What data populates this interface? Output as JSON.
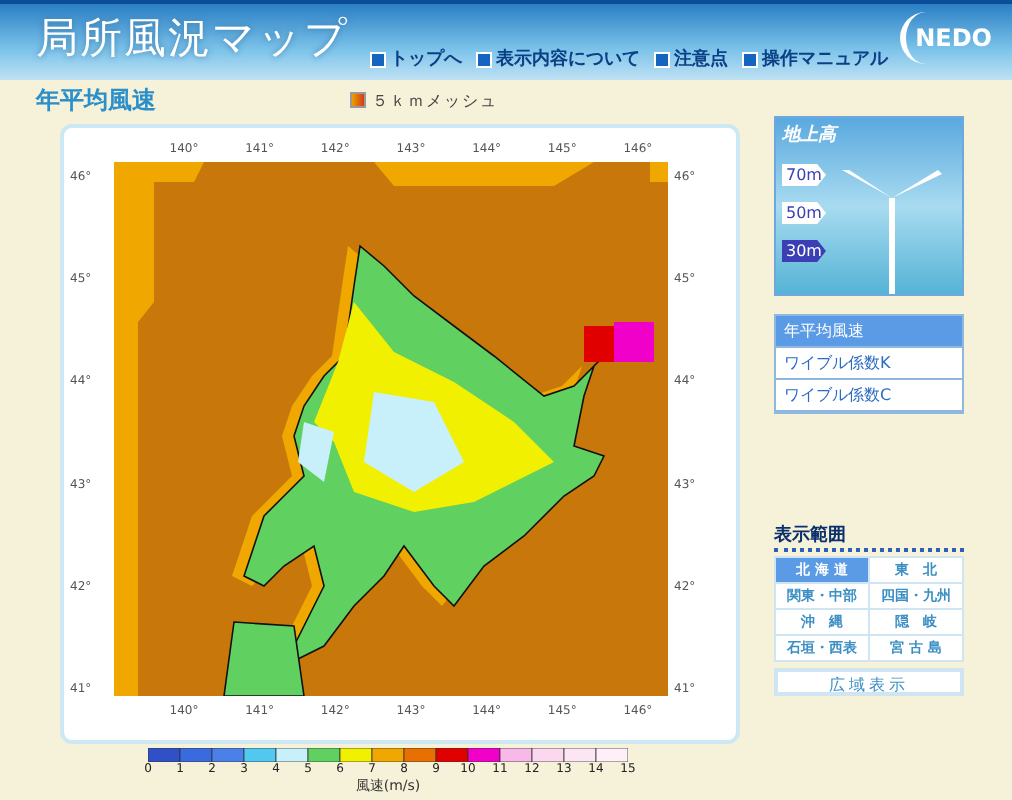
{
  "header": {
    "title": "局所風況マップ",
    "logo": "NEDO",
    "nav": [
      "トップへ",
      "表示内容について",
      "注意点",
      "操作マニュアル"
    ]
  },
  "page_title": "年平均風速",
  "mesh_label": "５ｋｍメッシュ",
  "map": {
    "lon_labels_top": [
      "140°",
      "141°",
      "142°",
      "143°",
      "144°",
      "145°",
      "146°"
    ],
    "lat_labels_left": [
      "46°",
      "45°",
      "44°",
      "43°",
      "42°",
      "41°"
    ],
    "lat_labels_right": [
      "46°",
      "45°",
      "44°",
      "43°",
      "42°",
      "41°"
    ],
    "lon_labels_bottom": [
      "140°",
      "141°",
      "142°",
      "143°",
      "144°",
      "145°",
      "146°"
    ],
    "legend_ticks": [
      "0",
      "1",
      "2",
      "3",
      "4",
      "5",
      "6",
      "7",
      "8",
      "9",
      "10",
      "11",
      "12",
      "13",
      "14",
      "15"
    ],
    "legend_title": "風速(m/s)"
  },
  "height_panel": {
    "title": "地上高",
    "options": [
      {
        "label": "70m",
        "selected": false
      },
      {
        "label": "50m",
        "selected": false
      },
      {
        "label": "30m",
        "selected": true
      }
    ]
  },
  "layer_menu": [
    {
      "label": "年平均風速",
      "selected": true
    },
    {
      "label": "ワイブル係数K",
      "selected": false
    },
    {
      "label": "ワイブル係数C",
      "selected": false
    }
  ],
  "region": {
    "title": "表示範囲",
    "items": [
      {
        "label": "北 海 道",
        "selected": true
      },
      {
        "label": "東　北",
        "selected": false
      },
      {
        "label": "関東・中部",
        "selected": false
      },
      {
        "label": "四国・九州",
        "selected": false
      },
      {
        "label": "沖　縄",
        "selected": false
      },
      {
        "label": "隠　岐",
        "selected": false
      },
      {
        "label": "石垣・西表",
        "selected": false
      },
      {
        "label": "宮 古 島",
        "selected": false
      }
    ],
    "wide_button": "広域表示"
  }
}
